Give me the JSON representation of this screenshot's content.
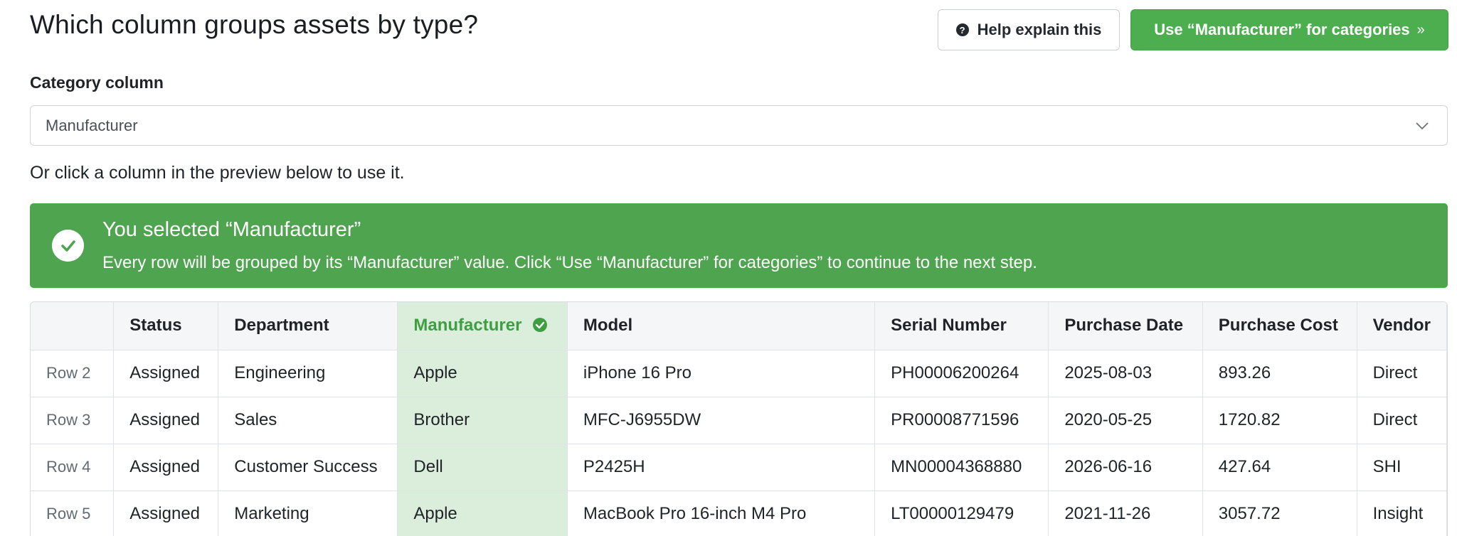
{
  "header": {
    "title": "Which column groups assets by type?",
    "help_button": "Help explain this",
    "use_button": "Use “Manufacturer” for categories"
  },
  "category": {
    "label": "Category column",
    "selected": "Manufacturer",
    "hint": "Or click a column in the preview below to use it."
  },
  "banner": {
    "title": "You selected “Manufacturer”",
    "description": "Every row will be grouped by its “Manufacturer” value. Click “Use “Manufacturer” for categories” to continue to the next step."
  },
  "table": {
    "columns": [
      "",
      "Status",
      "Department",
      "Manufacturer",
      "Model",
      "Serial Number",
      "Purchase Date",
      "Purchase Cost",
      "Vendor"
    ],
    "selected_column": "Manufacturer",
    "rows": [
      [
        "Row 2",
        "Assigned",
        "Engineering",
        "Apple",
        "iPhone 16 Pro",
        "PH00006200264",
        "2025-08-03",
        "893.26",
        "Direct"
      ],
      [
        "Row 3",
        "Assigned",
        "Sales",
        "Brother",
        "MFC-J6955DW",
        "PR00008771596",
        "2020-05-25",
        "1720.82",
        "Direct"
      ],
      [
        "Row 4",
        "Assigned",
        "Customer Success",
        "Dell",
        "P2425H",
        "MN00004368880",
        "2026-06-16",
        "427.64",
        "SHI"
      ],
      [
        "Row 5",
        "Assigned",
        "Marketing",
        "Apple",
        "MacBook Pro 16-inch M4 Pro",
        "LT00000129479",
        "2021-11-26",
        "3057.72",
        "Insight"
      ]
    ]
  },
  "colors": {
    "accent_green": "#4cae4f",
    "banner_green": "#4fa44f",
    "selected_column_bg": "#dbeedb",
    "selected_column_text": "#3f9e42"
  },
  "icons": {
    "help": "question-circle-icon",
    "use": "chevron-double-right-icon",
    "select": "chevron-down-icon",
    "banner": "check-circle-icon",
    "selected_column": "check-circle-icon"
  }
}
